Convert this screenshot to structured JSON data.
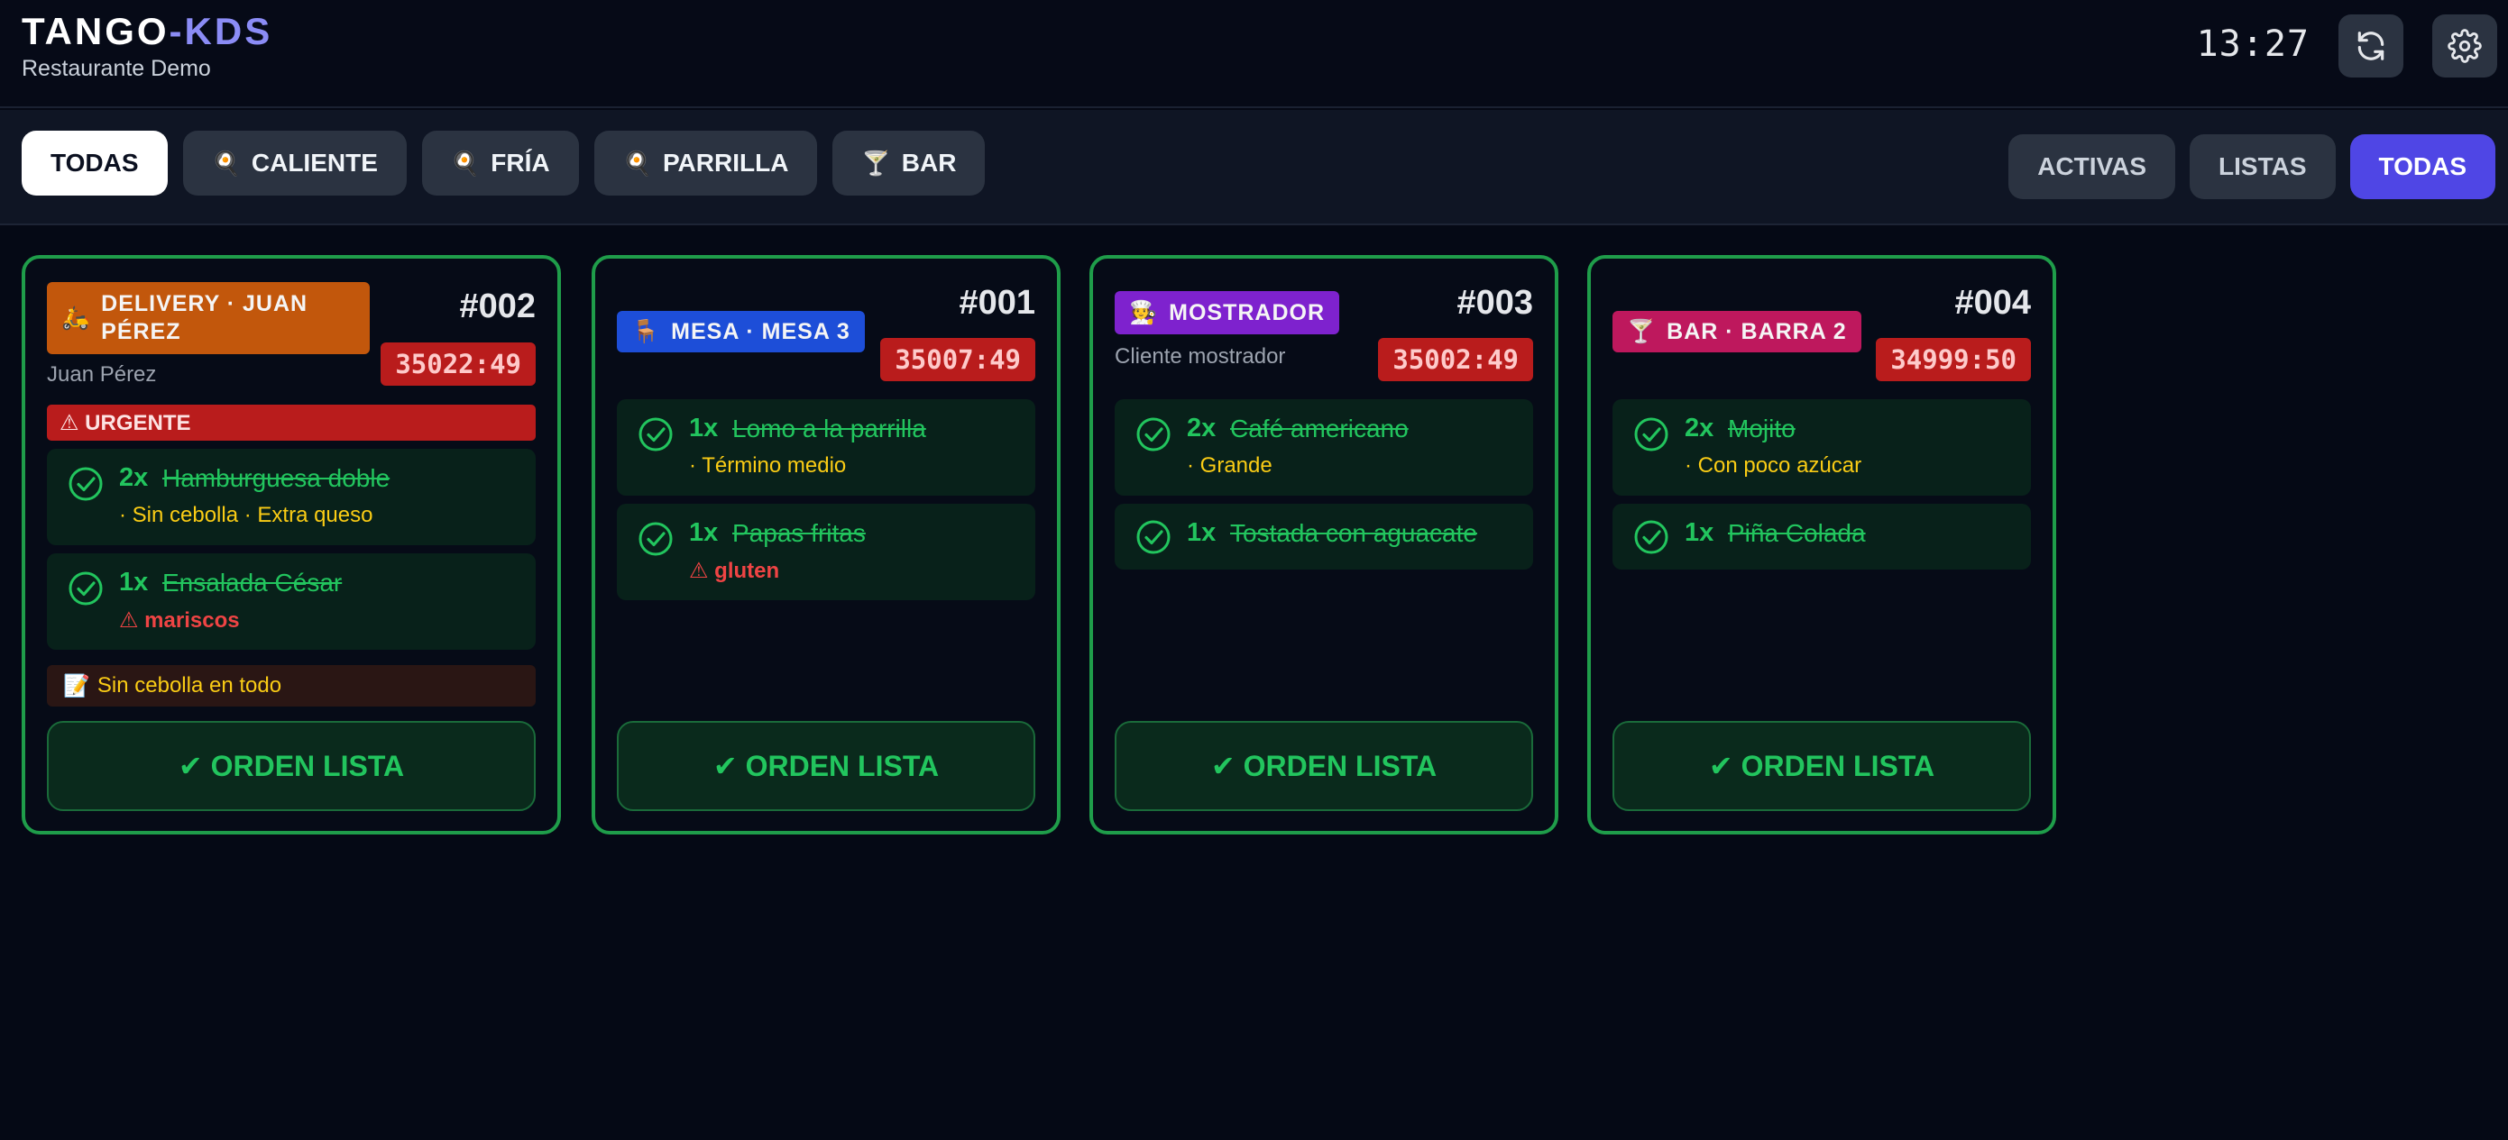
{
  "header": {
    "brand_main": "TANGO",
    "brand_sep": "-",
    "brand_accent": "KDS",
    "subtitle": "Restaurante Demo",
    "clock": "13:27",
    "refresh_icon": "refresh-icon",
    "settings_icon": "gear-icon"
  },
  "station_tabs": [
    {
      "label": "TODAS",
      "emoji": ""
    },
    {
      "label": "CALIENTE",
      "emoji": "🍳"
    },
    {
      "label": "FRÍA",
      "emoji": "🍳"
    },
    {
      "label": "PARRILLA",
      "emoji": "🍳"
    },
    {
      "label": "BAR",
      "emoji": "🍸"
    }
  ],
  "state_tabs": [
    {
      "label": "ACTIVAS"
    },
    {
      "label": "LISTAS"
    },
    {
      "label": "TODAS"
    }
  ],
  "colors": {
    "accent": "#4f46e5",
    "delivery": "#c2570c",
    "mesa": "#1d4ed8",
    "mostrador": "#7e22ce",
    "bar": "#be185d",
    "done_green": "#22c55e",
    "timer_red": "#b91c1c"
  },
  "orders": [
    {
      "badge_emoji": "🛵",
      "badge_line1": "DELIVERY · JUAN",
      "badge_line2": "PÉREZ",
      "number": "#002",
      "timer": "35022:49",
      "customer": "Juan Pérez",
      "urgent_label": "⚠ URGENTE",
      "items": [
        {
          "qty": "2x",
          "name": "Hamburguesa doble",
          "detail": "· Sin cebolla · Extra queso"
        },
        {
          "qty": "1x",
          "name": "Ensalada César",
          "allergen": "⚠ mariscos"
        }
      ],
      "note_emoji": "📝",
      "note": "Sin cebolla en todo",
      "action": "✔ ORDEN LISTA"
    },
    {
      "badge_emoji": "🪑",
      "badge_label": "MESA · MESA 3",
      "number": "#001",
      "timer": "35007:49",
      "items": [
        {
          "qty": "1x",
          "name": "Lomo a la parrilla",
          "detail": "· Término medio"
        },
        {
          "qty": "1x",
          "name": "Papas fritas",
          "allergen": "⚠ gluten"
        }
      ],
      "action": "✔ ORDEN LISTA"
    },
    {
      "badge_emoji": "🧑‍🍳",
      "badge_label": "MOSTRADOR",
      "number": "#003",
      "timer": "35002:49",
      "customer": "Cliente mostrador",
      "items": [
        {
          "qty": "2x",
          "name": "Café americano",
          "detail": "· Grande"
        },
        {
          "qty": "1x",
          "name": "Tostada con aguacate"
        }
      ],
      "action": "✔ ORDEN LISTA"
    },
    {
      "badge_emoji": "🍸",
      "badge_label": "BAR · BARRA 2",
      "number": "#004",
      "timer": "34999:50",
      "items": [
        {
          "qty": "2x",
          "name": "Mojito",
          "detail": "· Con poco azúcar"
        },
        {
          "qty": "1x",
          "name": "Piña Colada"
        }
      ],
      "action": "✔ ORDEN LISTA"
    }
  ]
}
